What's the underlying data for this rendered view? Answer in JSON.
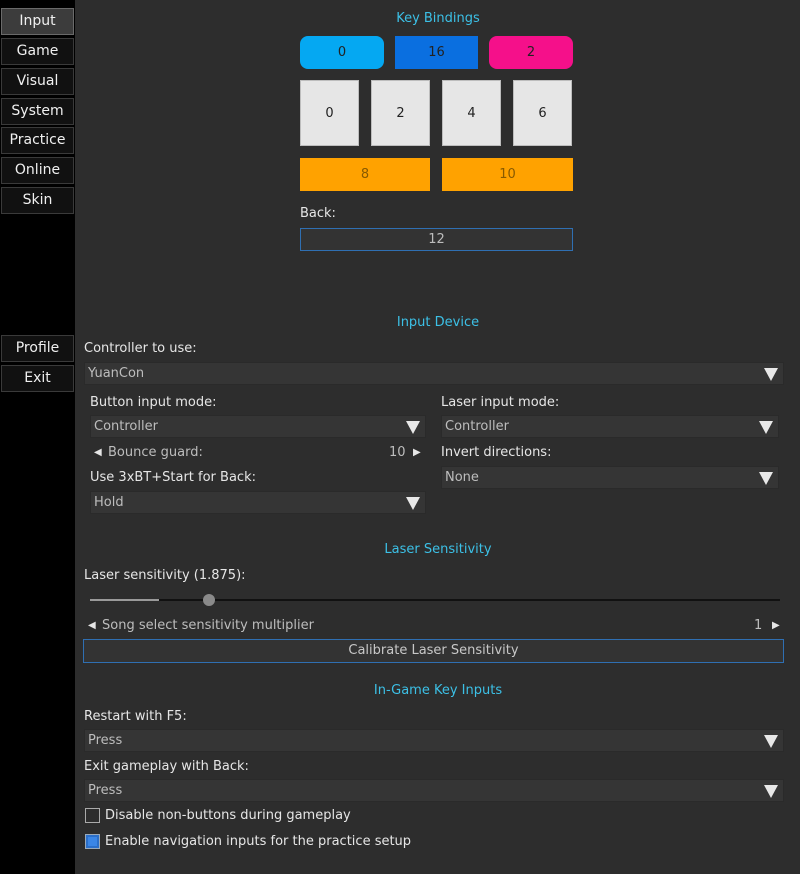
{
  "sidebar": {
    "top_items": [
      {
        "label": "Input",
        "active": true
      },
      {
        "label": "Game"
      },
      {
        "label": "Visual"
      },
      {
        "label": "System"
      },
      {
        "label": "Practice"
      },
      {
        "label": "Online"
      },
      {
        "label": "Skin"
      }
    ],
    "bottom_items": [
      {
        "label": "Profile"
      },
      {
        "label": "Exit"
      }
    ]
  },
  "key_bindings": {
    "title": "Key Bindings",
    "fx_top": [
      {
        "value": "0",
        "color": "#05a8f2"
      },
      {
        "value": "16",
        "color": "#0a6fe0"
      },
      {
        "value": "2",
        "color": "#f5108a"
      }
    ],
    "bt": [
      "0",
      "2",
      "4",
      "6"
    ],
    "fx": [
      "8",
      "10"
    ],
    "back_label": "Back:",
    "back_value": "12"
  },
  "input_device": {
    "title": "Input Device",
    "controller_label": "Controller to use:",
    "controller_value": "YuanCon",
    "button_mode_label": "Button input mode:",
    "button_mode_value": "Controller",
    "laser_mode_label": "Laser input mode:",
    "laser_mode_value": "Controller",
    "bounce_label": "Bounce guard:",
    "bounce_value": "10",
    "invert_label": "Invert directions:",
    "invert_value": "None",
    "back_combo_label": "Use 3xBT+Start for Back:",
    "back_combo_value": "Hold"
  },
  "laser_sensitivity": {
    "title": "Laser Sensitivity",
    "label": "Laser sensitivity (1.875):",
    "slider_fraction": 0.1,
    "multiplier_label": "Song select sensitivity multiplier",
    "multiplier_value": "1",
    "calibrate_label": "Calibrate Laser Sensitivity"
  },
  "ingame": {
    "title": "In-Game Key Inputs",
    "restart_label": "Restart with F5:",
    "restart_value": "Press",
    "exit_label": "Exit gameplay with Back:",
    "exit_value": "Press",
    "disable_label": "Disable non-buttons during gameplay",
    "disable_checked": false,
    "nav_label": "Enable navigation inputs for the practice setup",
    "nav_checked": true
  },
  "colors": {
    "accent_title": "#3cc0e6",
    "fx_orange": "#ffa200",
    "checkbox_blue": "#3a86e6"
  }
}
